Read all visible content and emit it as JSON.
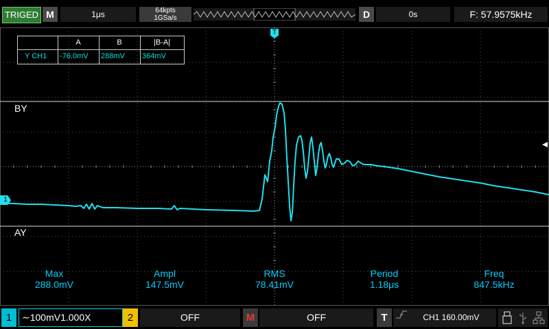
{
  "top": {
    "trigger_status": "TRIGED",
    "menu_button": "M",
    "timebase": "1μs",
    "memory_depth": "64kpts",
    "sample_rate": "1GSa/s",
    "delay_button": "D",
    "delay": "0s",
    "frequency": "F: 57.9575kHz"
  },
  "cursor_table": {
    "header": [
      "",
      "A",
      "B",
      "|B-A|"
    ],
    "row": [
      "Y CH1",
      "-76.0mV",
      "288mV",
      "364mV"
    ]
  },
  "cursors": {
    "by_label": "BY",
    "ay_label": "AY"
  },
  "trigger_marker": "T",
  "channel_marker": "1",
  "measurements": [
    {
      "name": "Max",
      "value": "288.0mV"
    },
    {
      "name": "Ampl",
      "value": "147.5mV"
    },
    {
      "name": "RMS",
      "value": "78.41mV"
    },
    {
      "name": "Period",
      "value": "1.18μs"
    },
    {
      "name": "Freq",
      "value": "847.5kHz"
    }
  ],
  "bottom": {
    "ch1_number": "1",
    "ch1_setting": "∼100mV1.000X",
    "ch2_number": "2",
    "ch2_setting": "OFF",
    "math_label": "M",
    "math_setting": "OFF",
    "trigger_label": "T",
    "trigger_setting": "CH1 160.00mV"
  },
  "colors": {
    "trace": "#1fe0ec",
    "grid": "#6a6a6a",
    "cursor_line": "#dcdcdc",
    "measurement_text": "#00cfff"
  },
  "icons": [
    "memory-strip-icon",
    "rising-edge-icon",
    "usb-drive-icon",
    "usb-icon",
    "network-icon"
  ]
}
